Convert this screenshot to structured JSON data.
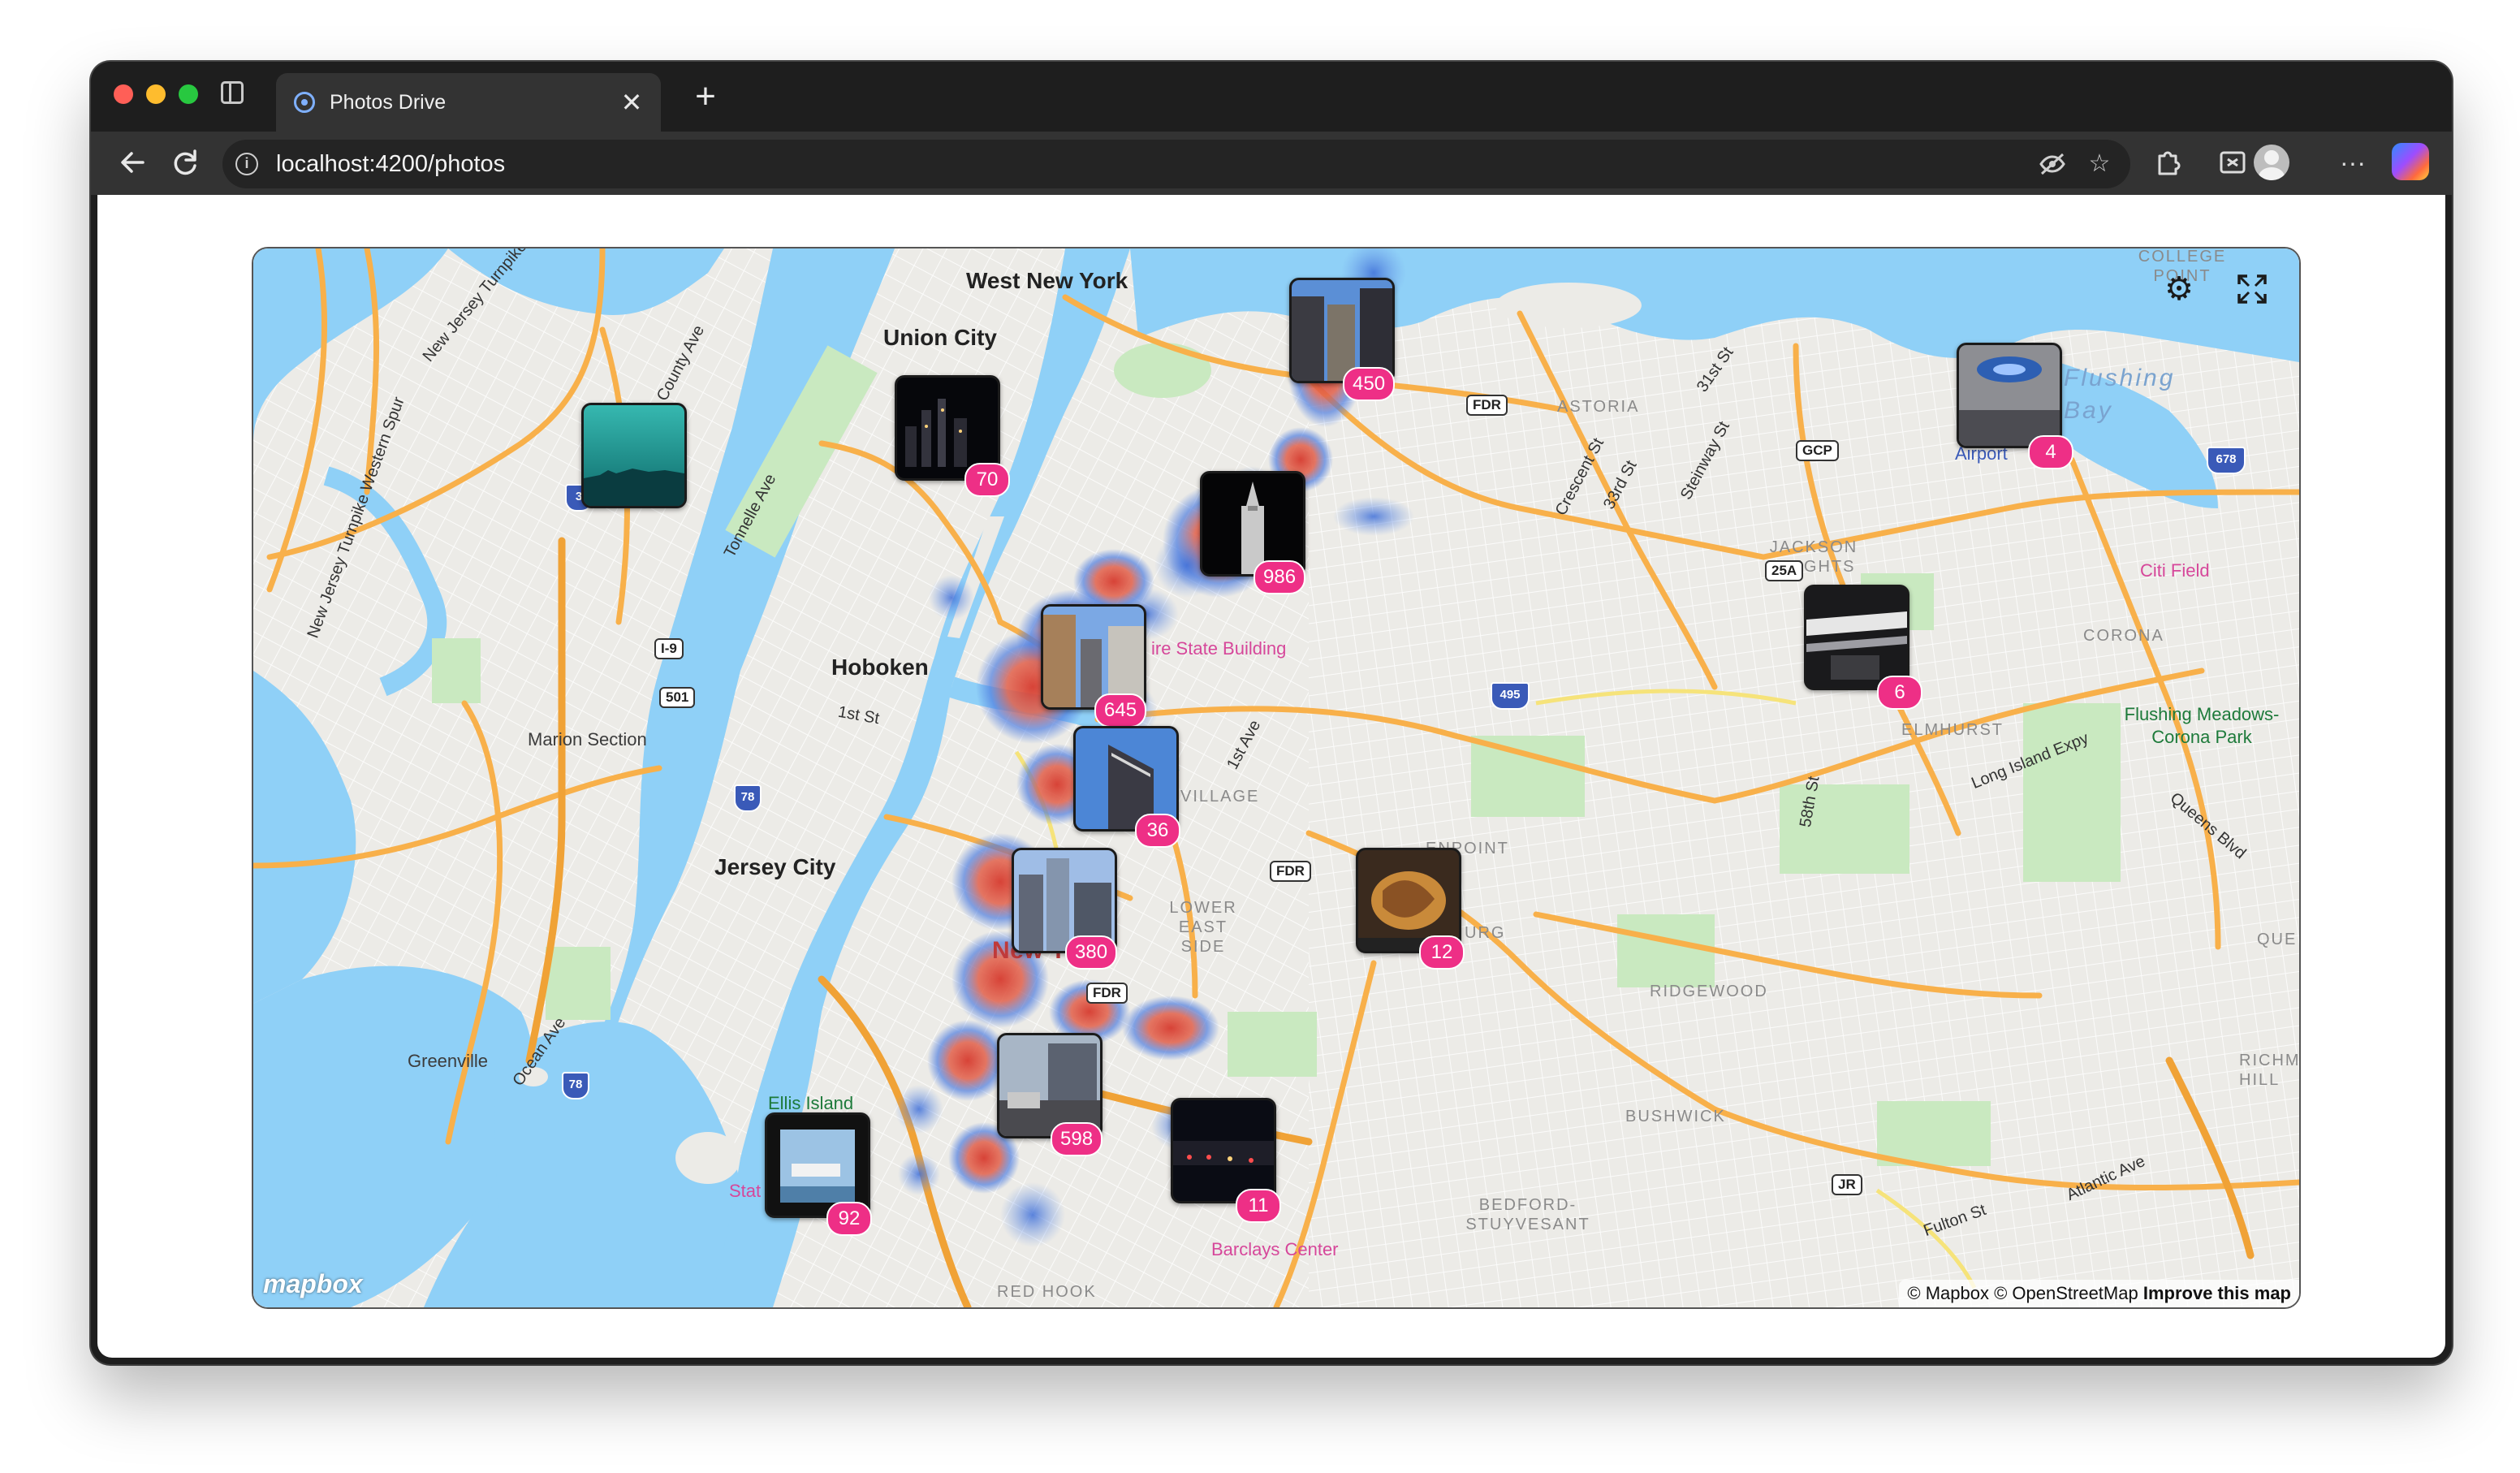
{
  "browser": {
    "tab_title": "Photos Drive",
    "tab_close": "✕",
    "new_tab": "+",
    "url": "localhost:4200/photos",
    "icons": [
      "sidebar-icon",
      "back-arrow-icon",
      "reload-icon",
      "info-icon",
      "eye-off-icon",
      "star-icon",
      "extensions-icon",
      "screenshot-icon",
      "profile-avatar",
      "more-icon",
      "copilot-icon"
    ]
  },
  "map": {
    "settings_icon": "⚙",
    "fullscreen_icon": "⛶",
    "logo": "mapbox",
    "attribution": "© Mapbox © OpenStreetMap",
    "improve": "Improve this map",
    "places": {
      "west_new_york": "West New York",
      "union_city": "Union City",
      "hoboken": "Hoboken",
      "jersey_city": "Jersey City",
      "marion_section": "Marion Section",
      "greenville": "Greenville",
      "ellis_island": "Ellis Island",
      "statue": "Stat",
      "new_york": "New York",
      "empire": "ire State Building",
      "village": "VILLAGE",
      "lower_east_side": "LOWER EAST SIDE",
      "greenpoint": "ENPOINT",
      "williamsburg": "URG",
      "astoria": "ASTORIA",
      "jackson_heights": "JACKSON HEIGHTS",
      "corona": "CORONA",
      "elmhurst": "ELMHURST",
      "ridgewood": "RIDGEWOOD",
      "bushwick": "BUSHWICK",
      "bedford": "BEDFORD- STUYVESANT",
      "red_hook": "RED HOOK",
      "barclays": "Barclays Center",
      "citi_field": "Citi Field",
      "flushing_park": "Flushing Meadows- Corona Park",
      "flushing_bay": "Flushing Bay",
      "airport": "Airport",
      "college": "COLLEGE POINT",
      "richmond_hill": "RICHMO HILL",
      "que": "QUE",
      "first_st": "1st St",
      "first_ave": "1st Ave",
      "county_ave": "County Ave",
      "tonnelle": "Tonnelle Ave",
      "ocean_ave": "Ocean Ave",
      "nj_turnpike": "New Jersey Turnpike",
      "nj_turnpike_w": "New Jersey Turnpike Western Spur",
      "crescent": "Crescent St",
      "thirty_third": "33rd St",
      "steinway": "Steinway St",
      "thirty_first": "31st St",
      "fifty_eighth": "58th St",
      "long_island_expy": "Long Island Expy",
      "queens_blvd": "Queens Blvd",
      "atlantic_ave": "Atlantic Ave",
      "fulton_st": "Fulton St"
    },
    "shields": {
      "fdr1": "FDR",
      "fdr2": "FDR",
      "fdr3": "FDR",
      "gcp": "GCP",
      "r25a": "25A",
      "i95": "I-9",
      "r501": "501",
      "jr": "JR",
      "i678": "678",
      "i495": "495",
      "i78a": "78",
      "i78b": "78",
      "i1": "3"
    },
    "clusters": [
      {
        "id": "c450",
        "count": "450",
        "photo": "skyscraper-blue-sky"
      },
      {
        "id": "c70",
        "count": "70",
        "photo": "night-skyline"
      },
      {
        "id": "c4",
        "count": "4",
        "photo": "airport-terminal"
      },
      {
        "id": "c986",
        "count": "986",
        "photo": "chrysler-night"
      },
      {
        "id": "c645",
        "count": "645",
        "photo": "midtown-buildings"
      },
      {
        "id": "c6",
        "count": "6",
        "photo": "interior-lights"
      },
      {
        "id": "c36",
        "count": "36",
        "photo": "tower-blue-sky"
      },
      {
        "id": "c380",
        "count": "380",
        "photo": "downtown-towers"
      },
      {
        "id": "c12",
        "count": "12",
        "photo": "street-mural"
      },
      {
        "id": "c598",
        "count": "598",
        "photo": "street-view"
      },
      {
        "id": "c11",
        "count": "11",
        "photo": "night-street"
      },
      {
        "id": "c92",
        "count": "92",
        "photo": "ferry-frame"
      },
      {
        "id": "c-teal",
        "count": "",
        "photo": "teal-skyline"
      }
    ]
  }
}
